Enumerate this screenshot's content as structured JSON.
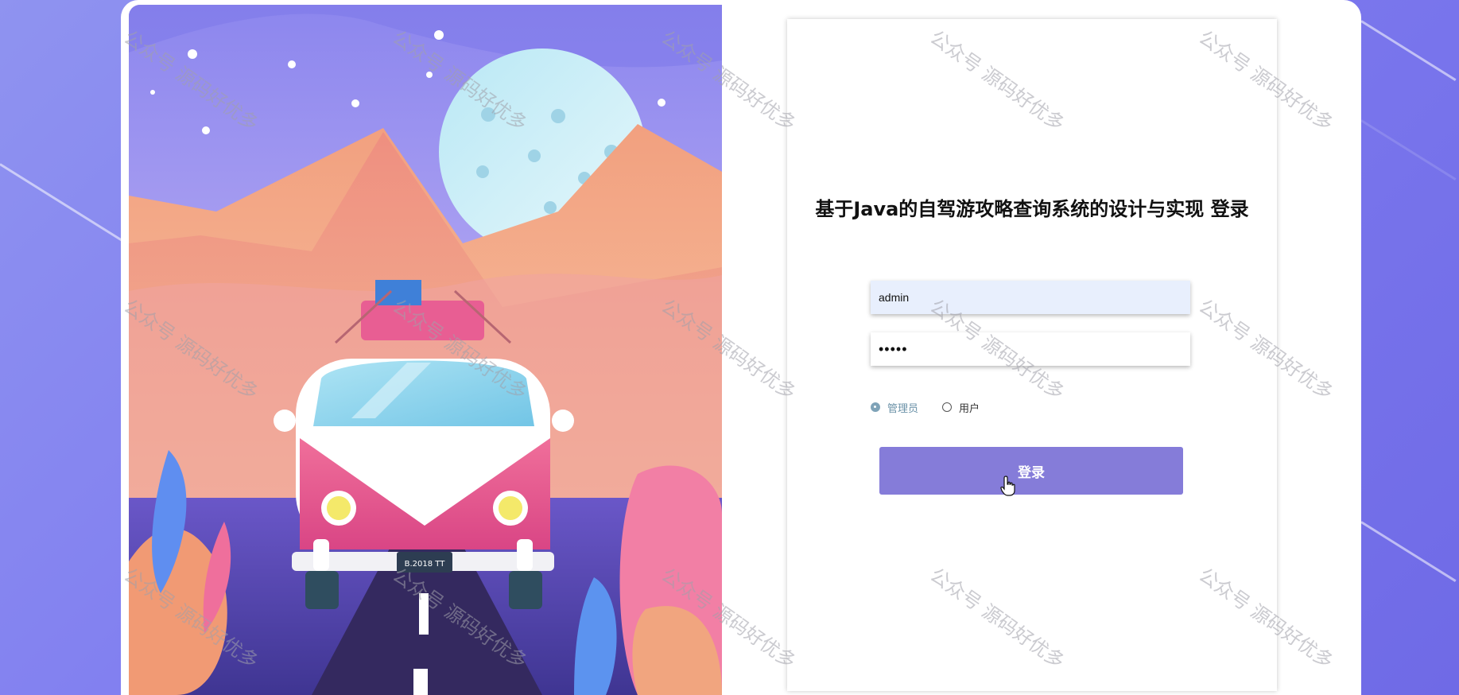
{
  "login": {
    "title": "基于Java的自驾游攻略查询系统的设计与实现 登录",
    "username": {
      "value": "admin",
      "placeholder": ""
    },
    "password": {
      "value": "•••••",
      "placeholder": ""
    },
    "roles": [
      {
        "label": "管理员",
        "checked": true
      },
      {
        "label": "用户",
        "checked": false
      }
    ],
    "submit_label": "登录"
  },
  "illustration": {
    "plate_text": "B.2018 TT",
    "icon": "campervan-road-illustration"
  },
  "watermark": {
    "text": "公众号 源码好优多"
  },
  "colors": {
    "background": "#7f7cf0",
    "button": "#857cd9",
    "username_field": "#e8effd",
    "radio_checked": "#7fa3b8"
  }
}
